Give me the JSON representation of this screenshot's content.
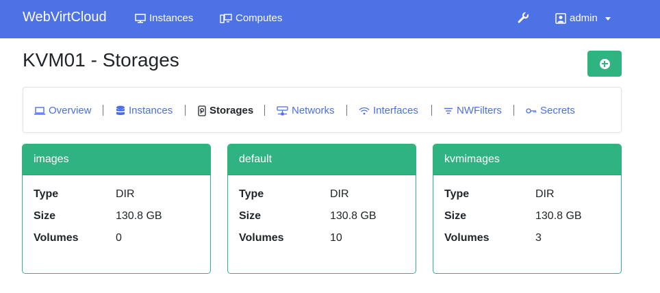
{
  "navbar": {
    "brand": "WebVirtCloud",
    "instances_label": "Instances",
    "computes_label": "Computes",
    "user_label": "admin"
  },
  "page": {
    "title": "KVM01 - Storages"
  },
  "tabs": [
    {
      "label": "Overview",
      "icon": "laptop-icon"
    },
    {
      "label": "Instances",
      "icon": "database-icon"
    },
    {
      "label": "Storages",
      "icon": "hdd-icon",
      "active": true
    },
    {
      "label": "Networks",
      "icon": "network-icon"
    },
    {
      "label": "Interfaces",
      "icon": "wifi-icon"
    },
    {
      "label": "NWFilters",
      "icon": "filter-icon"
    },
    {
      "label": "Secrets",
      "icon": "key-icon"
    }
  ],
  "storages": [
    {
      "name": "images",
      "type_label": "Type",
      "type": "DIR",
      "size_label": "Size",
      "size": "130.8 GB",
      "volumes_label": "Volumes",
      "volumes": "0"
    },
    {
      "name": "default",
      "type_label": "Type",
      "type": "DIR",
      "size_label": "Size",
      "size": "130.8 GB",
      "volumes_label": "Volumes",
      "volumes": "10"
    },
    {
      "name": "kvmimages",
      "type_label": "Type",
      "type": "DIR",
      "size_label": "Size",
      "size": "130.8 GB",
      "volumes_label": "Volumes",
      "volumes": "3"
    }
  ],
  "colors": {
    "navbar": "#4d72e6",
    "accent_green": "#2fb380",
    "link_blue": "#4a6ee8"
  }
}
